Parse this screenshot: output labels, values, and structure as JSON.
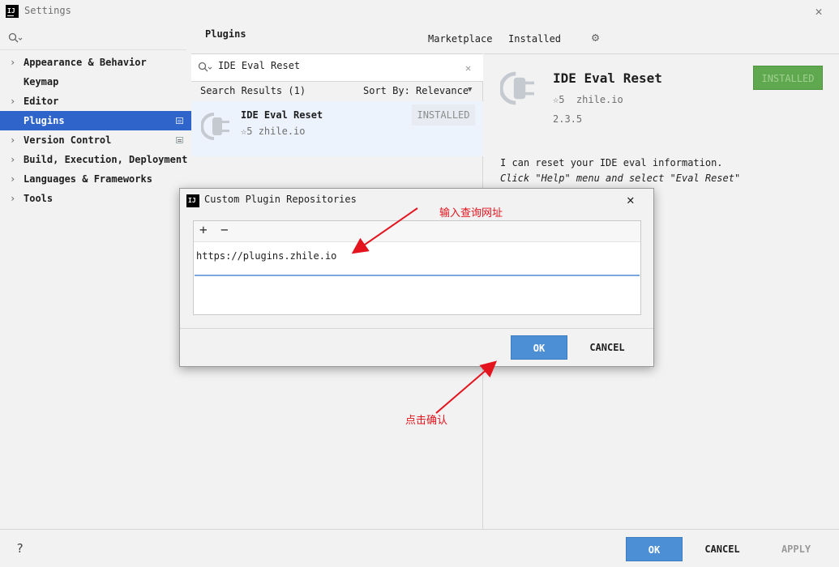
{
  "window": {
    "title": "Settings",
    "logo_text": "IJ"
  },
  "sidebar": {
    "items": [
      {
        "label": "Appearance & Behavior",
        "has_arrow": true
      },
      {
        "label": "Keymap",
        "has_arrow": false
      },
      {
        "label": "Editor",
        "has_arrow": true
      },
      {
        "label": "Plugins",
        "has_arrow": false,
        "selected": true
      },
      {
        "label": "Version Control",
        "has_arrow": true
      },
      {
        "label": "Build, Execution, Deployment",
        "has_arrow": true
      },
      {
        "label": "Languages & Frameworks",
        "has_arrow": true
      },
      {
        "label": "Tools",
        "has_arrow": true
      }
    ]
  },
  "plugins": {
    "title": "Plugins",
    "tabs": [
      "Marketplace",
      "Installed"
    ],
    "search_value": "IDE Eval Reset",
    "results_label": "Search Results (1)",
    "sort_label": "Sort By: Relevance",
    "result": {
      "name": "IDE Eval Reset",
      "rating": "5",
      "vendor": "zhile.io",
      "badge": "INSTALLED"
    }
  },
  "detail": {
    "name": "IDE Eval Reset",
    "rating": "5",
    "vendor": "zhile.io",
    "version": "2.3.5",
    "button": "INSTALLED",
    "description_line1": "I can reset your IDE eval information.",
    "description_line2": "Click \"Help\" menu and select \"Eval Reset\""
  },
  "dialog": {
    "title": "Custom Plugin Repositories",
    "add": "+",
    "remove": "−",
    "url": "https://plugins.zhile.io",
    "ok": "OK",
    "cancel": "CANCEL"
  },
  "bottom": {
    "help": "?",
    "ok": "OK",
    "cancel": "CANCEL",
    "apply": "APPLY"
  },
  "annotations": {
    "input_note": "输入查询网址",
    "confirm_note": "点击确认"
  },
  "colors": {
    "selection": "#2f65ca",
    "ok_button": "#4d8fd4",
    "installed_green": "#5fa84f",
    "annotation_red": "#e3141e"
  }
}
